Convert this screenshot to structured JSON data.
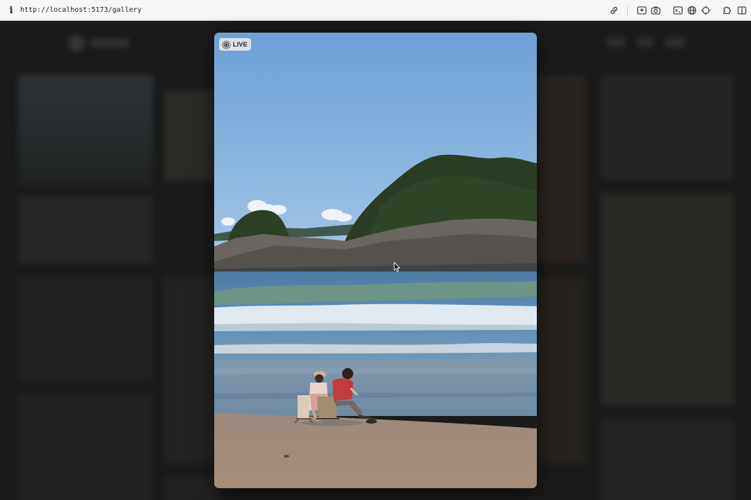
{
  "browser": {
    "url": "http://localhost:5173/gallery",
    "info_icon": "info-icon",
    "toolbar_icons": [
      "link-icon",
      "screenshot-area-icon",
      "camera-icon",
      "terminal-icon",
      "globe-icon",
      "crosshair-icon",
      "extension-icon",
      "sidebar-icon"
    ]
  },
  "lightbox": {
    "badge_label": "LIVE",
    "badge_icon": "live-photo-icon",
    "photo_subject": "two-people-on-beach-chairs-by-sea"
  },
  "colors": {
    "backdrop": "#1b1b1b",
    "sky_top": "#6fa0d6",
    "sea": "#4f7fa6",
    "sand": "#a08a7a"
  }
}
